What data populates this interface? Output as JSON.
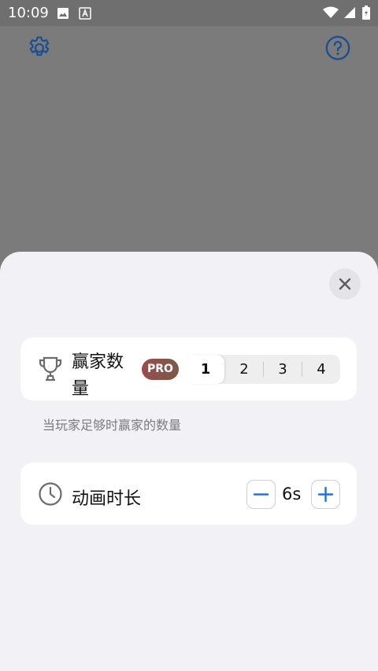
{
  "status_bar": {
    "time": "10:09",
    "icons": [
      "image-icon",
      "a-badge-icon",
      "wifi-icon",
      "signal-icon",
      "battery-icon"
    ]
  },
  "toolbar": {
    "settings_icon": "gear-icon",
    "help_icon": "question-circle-icon",
    "accent": "#1d4f91"
  },
  "sheet": {
    "close_icon": "close-icon",
    "winners_card": {
      "icon": "trophy-icon",
      "label_line1": "赢家数",
      "label_line2": "量",
      "badge": "PRO",
      "options": [
        "1",
        "2",
        "3",
        "4"
      ],
      "selected": "1",
      "hint": "当玩家足够时赢家的数量"
    },
    "duration_card": {
      "icon": "clock-icon",
      "label": "动画时长",
      "minus_icon": "minus-icon",
      "value": "6s",
      "plus_icon": "plus-icon",
      "stepper_accent": "#1a73e8"
    }
  }
}
